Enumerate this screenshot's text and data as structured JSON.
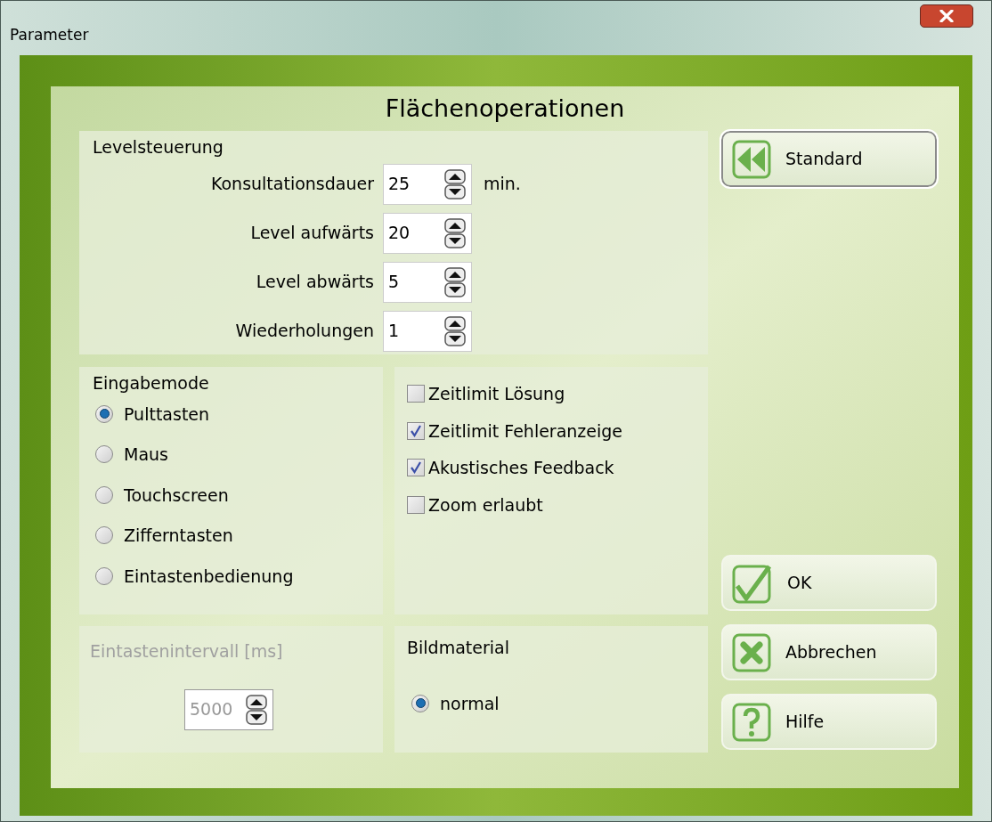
{
  "window": {
    "title": "Parameter"
  },
  "heading": "Flächenoperationen",
  "level_control": {
    "title": "Levelsteuerung",
    "fields": [
      {
        "label": "Konsultationsdauer",
        "value": "25",
        "unit": "min."
      },
      {
        "label": "Level aufwärts",
        "value": "20"
      },
      {
        "label": "Level abwärts",
        "value": "5"
      },
      {
        "label": "Wiederholungen",
        "value": "1"
      }
    ]
  },
  "input_mode": {
    "title": "Eingabemode",
    "options": [
      {
        "label": "Pulttasten",
        "selected": true
      },
      {
        "label": "Maus",
        "selected": false
      },
      {
        "label": "Touchscreen",
        "selected": false
      },
      {
        "label": "Zifferntasten",
        "selected": false
      },
      {
        "label": "Eintastenbedienung",
        "selected": false
      }
    ]
  },
  "options": [
    {
      "label": "Zeitlimit Lösung",
      "checked": false
    },
    {
      "label": "Zeitlimit Fehleranzeige",
      "checked": true
    },
    {
      "label": "Akustisches Feedback",
      "checked": true
    },
    {
      "label": "Zoom erlaubt",
      "checked": false
    }
  ],
  "key_interval": {
    "title": "Eintastenintervall [ms]",
    "value": "5000",
    "disabled": true
  },
  "image_material": {
    "title": "Bildmaterial",
    "options": [
      {
        "label": "normal",
        "selected": true
      }
    ]
  },
  "buttons": [
    {
      "kind": "standard",
      "label": "Standard"
    },
    {
      "kind": "ok",
      "label": "OK"
    },
    {
      "kind": "cancel",
      "label": "Abbrechen"
    },
    {
      "kind": "help",
      "label": "Hilfe"
    }
  ]
}
